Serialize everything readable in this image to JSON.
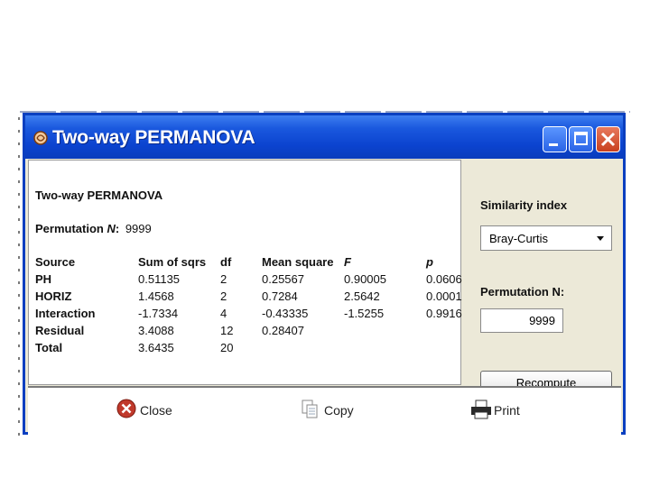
{
  "window": {
    "title": "Two-way PERMANOVA"
  },
  "results": {
    "heading": "Two-way PERMANOVA",
    "perm_label": "Permutation ",
    "perm_n": "N",
    "perm_colon": ":",
    "perm_value": "9999",
    "columns": [
      "Source",
      "Sum of sqrs",
      "df",
      "Mean square",
      "F",
      "p"
    ],
    "rows": [
      [
        "PH",
        "0.51135",
        "2",
        "0.25567",
        "0.90005",
        "0.0606"
      ],
      [
        "HORIZ",
        "1.4568",
        "2",
        "0.7284",
        "2.5642",
        "0.0001"
      ],
      [
        "Interaction",
        "-1.7334",
        "4",
        "-0.43335",
        "-1.5255",
        "0.9916"
      ],
      [
        "Residual",
        "3.4088",
        "12",
        "0.28407",
        "",
        ""
      ],
      [
        "Total",
        "3.6435",
        "20",
        "",
        "",
        ""
      ]
    ]
  },
  "side": {
    "similarity_label": "Similarity index",
    "similarity_value": "Bray-Curtis",
    "perm_label": "Permutation N:",
    "perm_value": "9999",
    "recompute_label": "Recompute"
  },
  "buttons": {
    "close": "Close",
    "copy": "Copy",
    "print": "Print"
  },
  "colors": {
    "titlebar": "#0b43cf",
    "window_bg": "#ece9d8",
    "close_icon": "#c0392b"
  }
}
